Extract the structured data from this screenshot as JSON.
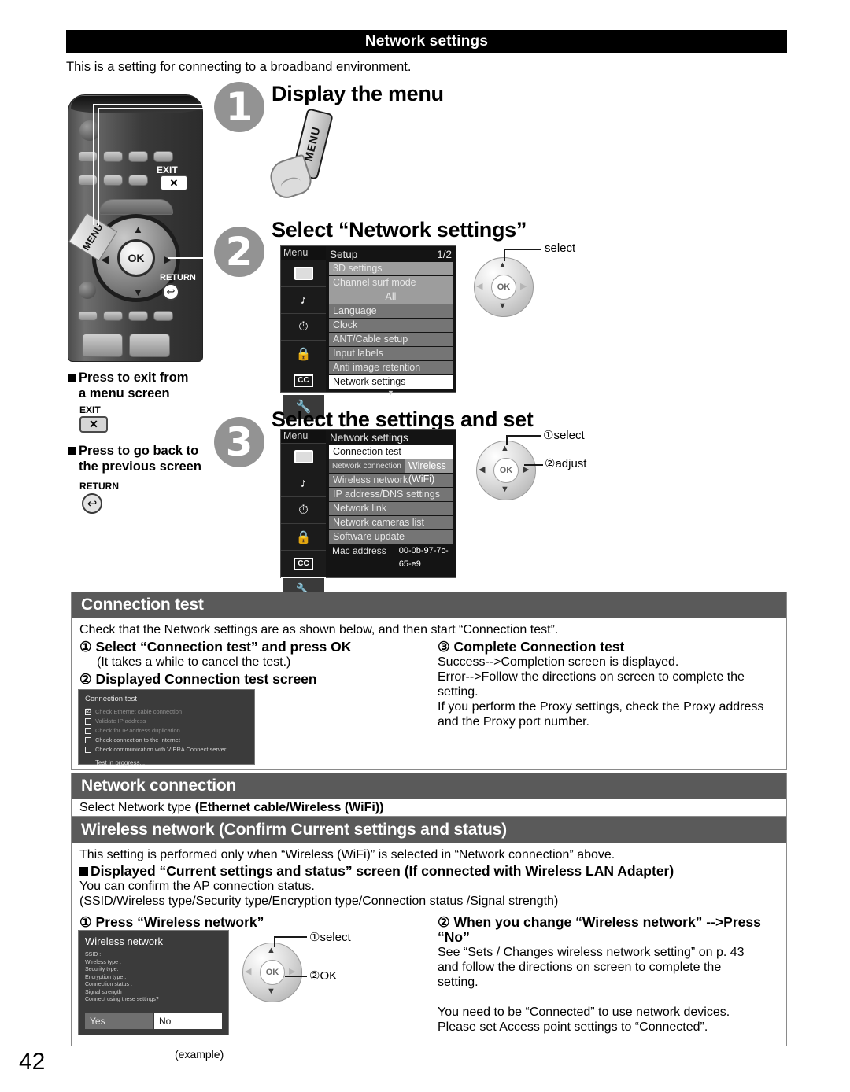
{
  "page": {
    "title": "Network settings",
    "intro": "This is a setting for connecting to a broadband environment.",
    "number": "42"
  },
  "steps": [
    {
      "num": "1",
      "heading": "Display the menu"
    },
    {
      "num": "2",
      "heading": "Select “Network settings”"
    },
    {
      "num": "3",
      "heading": "Select the settings and set"
    }
  ],
  "remote": {
    "menu_button_label": "MENU",
    "ok_label": "OK",
    "exit_label": "EXIT",
    "exit_glyph": "✕",
    "return_label": "RETURN",
    "return_glyph": "↩"
  },
  "hand_menu": {
    "button_label": "MENU"
  },
  "notes": [
    {
      "line1": "Press to exit from",
      "line2": "a menu screen",
      "key_label": "EXIT",
      "key_glyph": "✕"
    },
    {
      "line1": "Press to go back to",
      "line2": "the previous screen",
      "key_label": "RETURN",
      "key_glyph": "↩"
    }
  ],
  "menu_setup": {
    "side_title": "Menu",
    "icons": [
      "picture-icon",
      "audio-note-icon",
      "timer-icon",
      "lock-icon",
      "cc-icon",
      "tools-icon"
    ],
    "cc_label": "CC",
    "title": "Setup",
    "page_indicator": "1/2",
    "rows": [
      {
        "label": "3D settings",
        "style": "light"
      },
      {
        "label": "Channel surf mode",
        "style": "light"
      },
      {
        "label": "All",
        "style": "center"
      },
      {
        "label": "Language",
        "style": "normal"
      },
      {
        "label": "Clock",
        "style": "normal"
      },
      {
        "label": "ANT/Cable setup",
        "style": "normal"
      },
      {
        "label": "Input labels",
        "style": "normal"
      },
      {
        "label": "Anti image retention",
        "style": "normal"
      },
      {
        "label": "Network settings",
        "style": "selected"
      }
    ],
    "scroll_glyph": "▼"
  },
  "menu_network": {
    "side_title": "Menu",
    "cc_label": "CC",
    "title": "Network settings",
    "rows": [
      {
        "label": "Connection test",
        "style": "selected"
      },
      {
        "label": "Network connection",
        "value": "Wireless (WiFi)",
        "style": "split"
      },
      {
        "label": "Wireless network",
        "style": "normal"
      },
      {
        "label": "IP address/DNS settings",
        "style": "normal"
      },
      {
        "label": "Network link",
        "style": "normal"
      },
      {
        "label": "Network cameras list",
        "style": "normal"
      },
      {
        "label": "Software update",
        "style": "normal"
      },
      {
        "label": "Mac address",
        "value": "00-0b-97-7c-65-e9",
        "style": "plain"
      }
    ]
  },
  "navpads": {
    "step2": {
      "ok": "OK",
      "callouts": [
        "select"
      ]
    },
    "step3": {
      "ok": "OK",
      "callouts": [
        "①select",
        "②adjust"
      ]
    },
    "wireless": {
      "ok": "OK",
      "callouts": [
        "①select",
        "②OK"
      ]
    }
  },
  "connection_test": {
    "bar": "Connection test",
    "lead": "Check that the Network settings are as shown below, and then start “Connection test”.",
    "item1": "① Select “Connection test” and press OK",
    "item1_sub": "(It takes a while to cancel the test.)",
    "item2": "② Displayed Connection test screen",
    "item3": "③ Complete Connection test",
    "right_lines": [
      "Success-->Completion screen is displayed.",
      "Error-->Follow the directions on screen to complete the setting.",
      "If you perform the Proxy settings, check the Proxy address",
      "and the Proxy port number."
    ],
    "screen": {
      "title": "Connection test",
      "checks": [
        {
          "label": "Check Ethernet cable connection",
          "checked": true,
          "dim": true
        },
        {
          "label": "Validate IP address",
          "checked": false,
          "dim": true
        },
        {
          "label": "Check for IP address duplication",
          "checked": false,
          "dim": true
        },
        {
          "label": "Check connection to the Internet",
          "checked": false,
          "dim": false
        },
        {
          "label": "Check communication with VIERA Connect server.",
          "checked": false,
          "dim": false
        }
      ],
      "check_glyph": "☑",
      "progress": "Test in progress..."
    }
  },
  "network_connection": {
    "bar": "Network connection",
    "lead_normal": "Select Network type ",
    "lead_bold": "(Ethernet cable/Wireless (WiFi))"
  },
  "wireless_section": {
    "bar": "Wireless network (Confirm Current settings and status)",
    "line1": "This setting is performed only when “Wireless (WiFi)” is selected in “Network connection” above.",
    "heading": "Displayed “Current settings and status” screen (If connected with Wireless LAN Adapter)",
    "line2": "You can confirm the AP connection status.",
    "line3": "(SSID/Wireless type/Security type/Encryption type/Connection status /Signal strength)",
    "item1": "① Press “Wireless network”",
    "item2": "② When you change “Wireless network” -->Press “No”",
    "right_lines": [
      "See “Sets / Changes wireless network setting” on p. 43",
      "and follow the directions on screen to complete the",
      "setting.",
      "",
      "You need to be “Connected” to use network devices.",
      "Please set Access point settings to “Connected”."
    ],
    "example_caption": "(example)",
    "screen": {
      "title": "Wireless network",
      "fields": [
        "SSID :",
        "Wireless type :",
        "Security type:",
        "Encryption type :",
        "Connection status :",
        "Signal strength :",
        "Connect using these settings?"
      ],
      "yes": "Yes",
      "no": "No"
    }
  }
}
